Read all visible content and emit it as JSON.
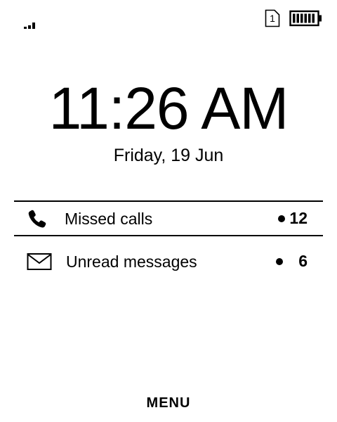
{
  "status_bar": {
    "signal_icon": "signal-strength-icon",
    "sim_slot": "1",
    "battery_icon": "battery-full-icon"
  },
  "clock": {
    "time": "11:26 AM",
    "date": "Friday, 19 Jun"
  },
  "notifications": [
    {
      "icon": "phone-icon",
      "label": "Missed calls",
      "count": "12",
      "selected": true
    },
    {
      "icon": "envelope-icon",
      "label": "Unread messages",
      "count": "6",
      "selected": false
    }
  ],
  "softkey": {
    "center_label": "MENU"
  }
}
